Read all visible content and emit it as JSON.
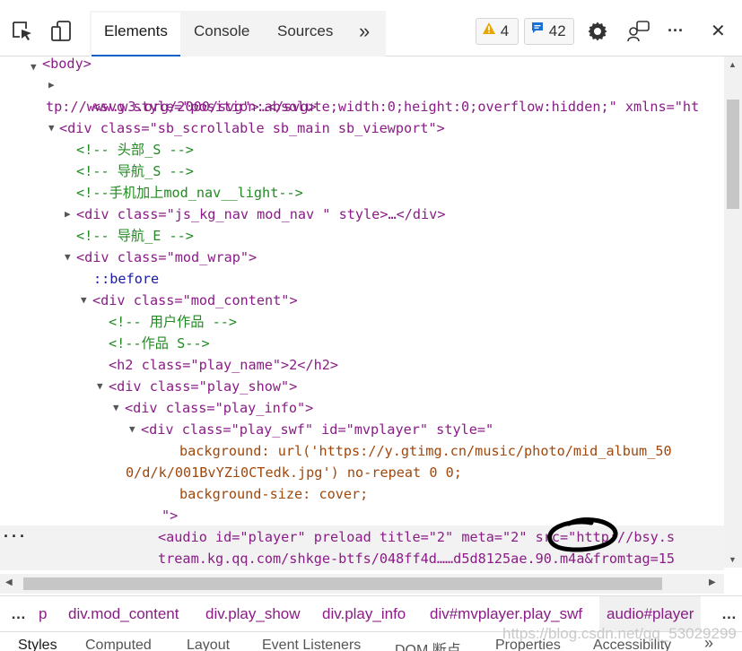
{
  "toolbar": {
    "tabs": [
      "Elements",
      "Console",
      "Sources"
    ],
    "more_tabs": "»",
    "warnings_count": "4",
    "messages_count": "42",
    "more_menu": "···",
    "close": "✕"
  },
  "tree": {
    "body_open": "<body>",
    "svg_line_1": "<svg style=\"position:absolute;width:0;height:0;overflow:hidden;\" xmlns=\"ht",
    "svg_line_2": "tp://www.w3.org/2000/svg\">…</svg>",
    "div_scrollable": "<div class=\"sb_scrollable sb_main sb_viewport\">",
    "comment_header": "<!-- 头部_S -->",
    "comment_nav_s": "<!-- 导航_S -->",
    "comment_mobile": "<!--手机加上mod_nav__light-->",
    "div_nav": "<div class=\"js_kg_nav mod_nav \" style>…</div>",
    "comment_nav_e": "<!-- 导航_E -->",
    "div_mod_wrap": "<div class=\"mod_wrap\">",
    "before": "::before",
    "div_mod_content": "<div class=\"mod_content\">",
    "comment_user_work": "<!-- 用户作品 -->",
    "comment_work_s": "<!--作品 S-->",
    "h2_line": "<h2 class=\"play_name\">2</h2>",
    "div_play_show": "<div class=\"play_show\">",
    "div_play_info": "<div class=\"play_info\">",
    "div_play_swf": "<div class=\"play_swf\" id=\"mvplayer\" style=\"",
    "bg_line_1": "background: url('https://y.gtimg.cn/music/photo/mid_album_50",
    "bg_line_2": "0/d/k/001BvYZi0CTedk.jpg') no-repeat 0 0;",
    "bg_size": "background-size: cover;",
    "style_close": "\">",
    "gutter_dots": "···",
    "audio_line_1": "<audio id=\"player\" preload title=\"2\" meta=\"2\" src=\"http://bsy.s",
    "audio_line_2": "tream.kg.qq.com/shkge-btfs/048ff4d……d5d8125ae.90.m4a&fromtag=15"
  },
  "breadcrumb": {
    "more": "…",
    "items": [
      "p",
      "div.mod_content",
      "div.play_show",
      "div.play_info",
      "div#mvplayer.play_swf",
      "audio#player"
    ],
    "next": "…"
  },
  "bottom_tabs": [
    "Styles",
    "Computed",
    "Layout",
    "Event Listeners",
    "DOM 断点",
    "Properties",
    "Accessibility"
  ],
  "bottom_more": "»",
  "watermark": "https://blog.csdn.net/qq_53029299"
}
